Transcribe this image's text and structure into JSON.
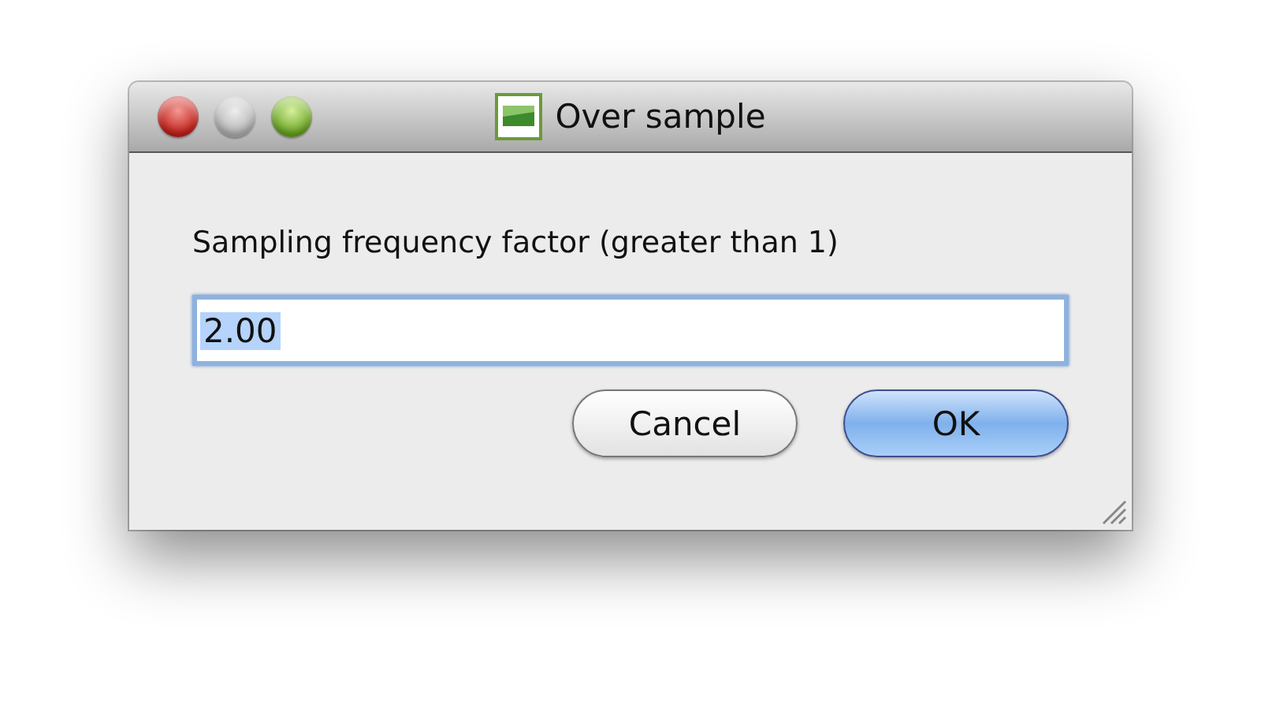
{
  "window": {
    "title": "Over sample"
  },
  "prompt": "Sampling frequency factor (greater than 1)",
  "field": {
    "value": "2.00",
    "text_selected": true
  },
  "buttons": [
    {
      "label": "Cancel",
      "kind": "normal"
    },
    {
      "label": "OK",
      "kind": "default"
    }
  ]
}
